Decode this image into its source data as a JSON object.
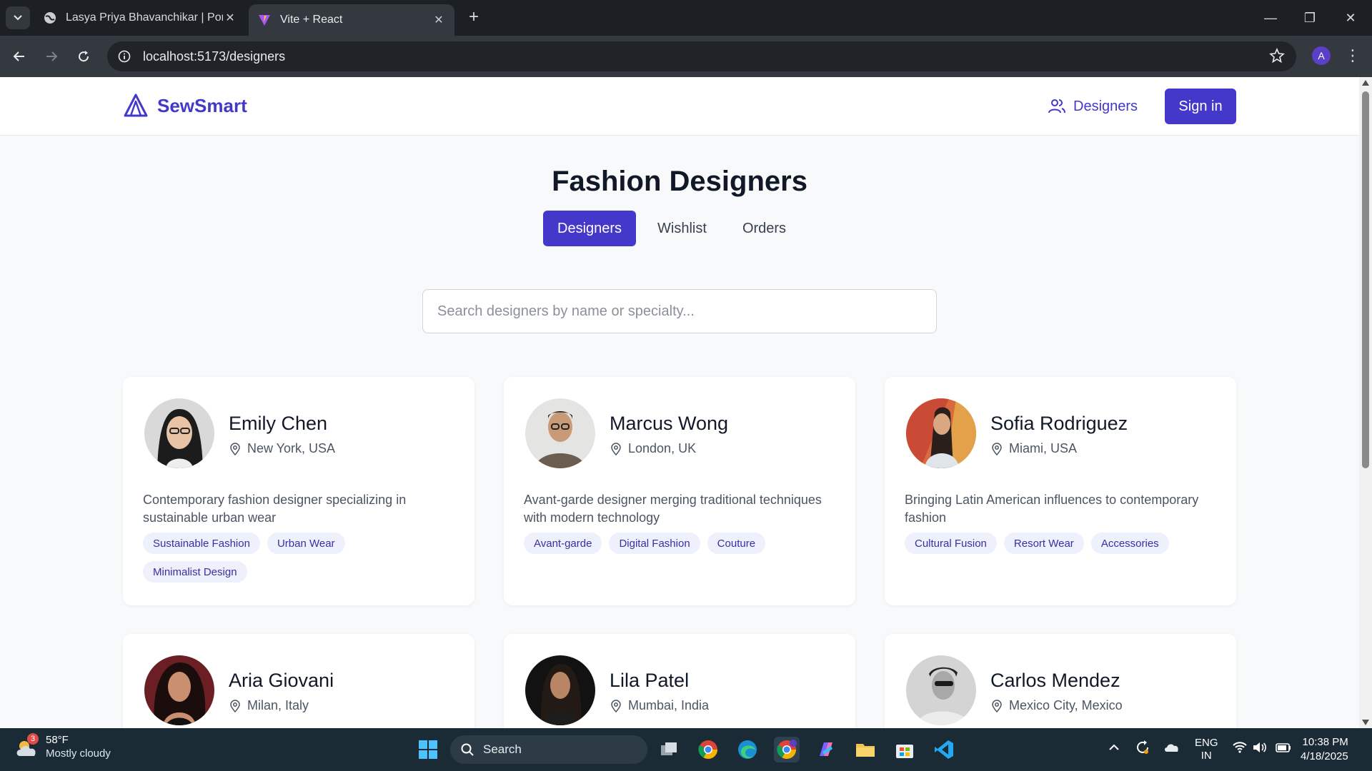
{
  "browser": {
    "tabs": [
      {
        "title": "Lasya Priya Bhavanchikar | Portf",
        "active": false
      },
      {
        "title": "Vite + React",
        "active": true
      }
    ],
    "url": "localhost:5173/designers",
    "profile_initial": "A"
  },
  "site": {
    "brand": "SewSmart",
    "nav_designers": "Designers",
    "signin": "Sign in",
    "accent": "#4338ca"
  },
  "main": {
    "title": "Fashion Designers",
    "tabs": [
      "Designers",
      "Wishlist",
      "Orders"
    ],
    "active_tab": "Designers",
    "search_placeholder": "Search designers by name or specialty..."
  },
  "designers": [
    {
      "name": "Emily Chen",
      "location": "New York, USA",
      "bio": "Contemporary fashion designer specializing in sustainable urban wear",
      "tags": [
        "Sustainable Fashion",
        "Urban Wear",
        "Minimalist Design"
      ]
    },
    {
      "name": "Marcus Wong",
      "location": "London, UK",
      "bio": "Avant-garde designer merging traditional techniques with modern technology",
      "tags": [
        "Avant-garde",
        "Digital Fashion",
        "Couture"
      ]
    },
    {
      "name": "Sofia Rodriguez",
      "location": "Miami, USA",
      "bio": "Bringing Latin American influences to contemporary fashion",
      "tags": [
        "Cultural Fusion",
        "Resort Wear",
        "Accessories"
      ]
    },
    {
      "name": "Aria Giovani",
      "location": "Milan, Italy",
      "bio": "",
      "tags": []
    },
    {
      "name": "Lila Patel",
      "location": "Mumbai, India",
      "bio": "",
      "tags": []
    },
    {
      "name": "Carlos Mendez",
      "location": "Mexico City, Mexico",
      "bio": "",
      "tags": []
    }
  ],
  "taskbar": {
    "weather_temp": "58°F",
    "weather_cond": "Mostly cloudy",
    "weather_badge": "3",
    "search": "Search",
    "lang1": "ENG",
    "lang2": "IN",
    "time": "10:38 PM",
    "date": "4/18/2025"
  }
}
